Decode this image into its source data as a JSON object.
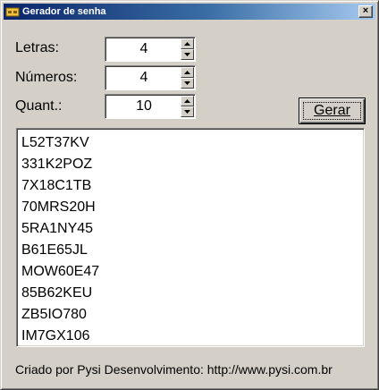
{
  "window": {
    "title": "Gerador de senha",
    "close_glyph": "×",
    "icon": "key-app-icon"
  },
  "fields": {
    "letras": {
      "label": "Letras:",
      "value": "4"
    },
    "numeros": {
      "label": "Números:",
      "value": "4"
    },
    "quant": {
      "label": "Quant.:",
      "value": "10"
    }
  },
  "gerar_button": {
    "label": "Gerar"
  },
  "passwords": [
    "L52T37KV",
    "331K2POZ",
    "7X18C1TB",
    "70MRS20H",
    "5RA1NY45",
    "B61E65JL",
    "MOW60E47",
    "85B62KEU",
    "ZB5IO780",
    "IM7GX106"
  ],
  "footer": "Criado por Pysi Desenvolvimento: http://www.pysi.com.br",
  "colors": {
    "face": "#d4d0c8",
    "title_start": "#0a246a",
    "title_end": "#a6caf0"
  }
}
